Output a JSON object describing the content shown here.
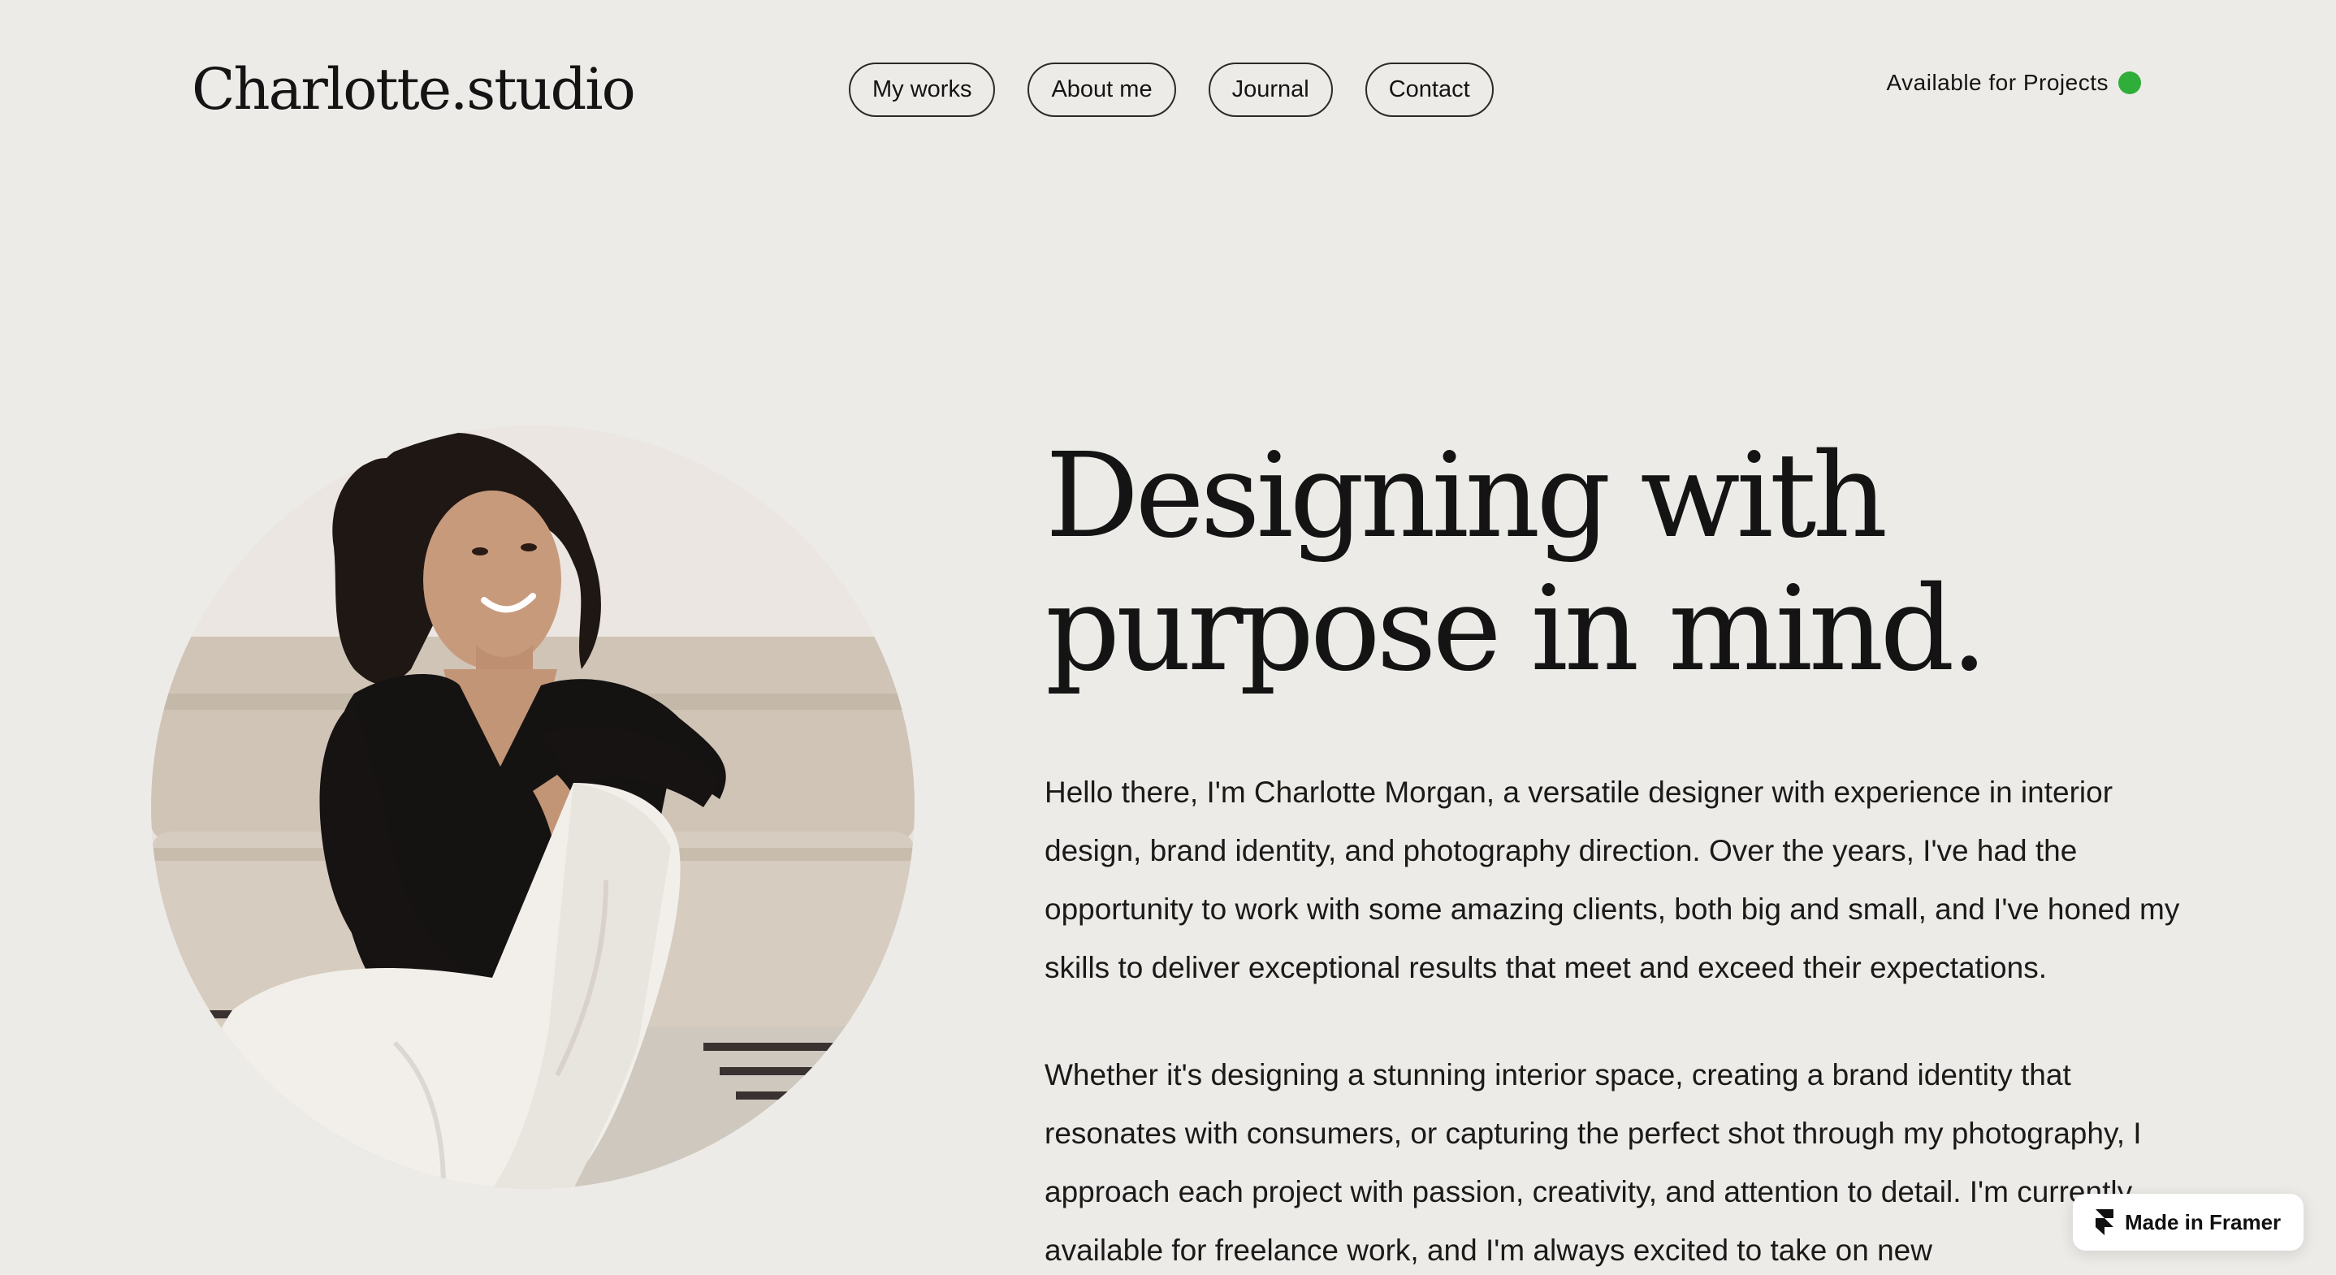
{
  "header": {
    "logo": "Charlotte.studio",
    "nav": [
      {
        "label": "My works"
      },
      {
        "label": "About me"
      },
      {
        "label": "Journal"
      },
      {
        "label": "Contact"
      }
    ],
    "availability": {
      "label": "Available for Projects",
      "status_color": "#2FAE3A"
    }
  },
  "hero": {
    "headline_line1": "Designing with",
    "headline_line2": "purpose in mind.",
    "bio_paragraph_1": "Hello there, I'm Charlotte Morgan, a versatile designer with experience in interior design, brand identity, and photography direction. Over the years, I've had the opportunity to work with some amazing clients, both big and small, and I've honed my skills to deliver exceptional results that meet and exceed their expectations.",
    "bio_paragraph_2": "Whether it's designing a stunning interior space, creating a brand identity that resonates with consumers, or capturing the perfect shot through my photography, I approach each project with passion, creativity, and attention to detail. I'm currently available for freelance work, and I'm always excited to take on new"
  },
  "badge": {
    "label": "Made in Framer",
    "icon": "framer-logo-icon"
  },
  "colors": {
    "background": "#EDEBE7",
    "text": "#141414",
    "available_dot": "#2FAE3A"
  }
}
